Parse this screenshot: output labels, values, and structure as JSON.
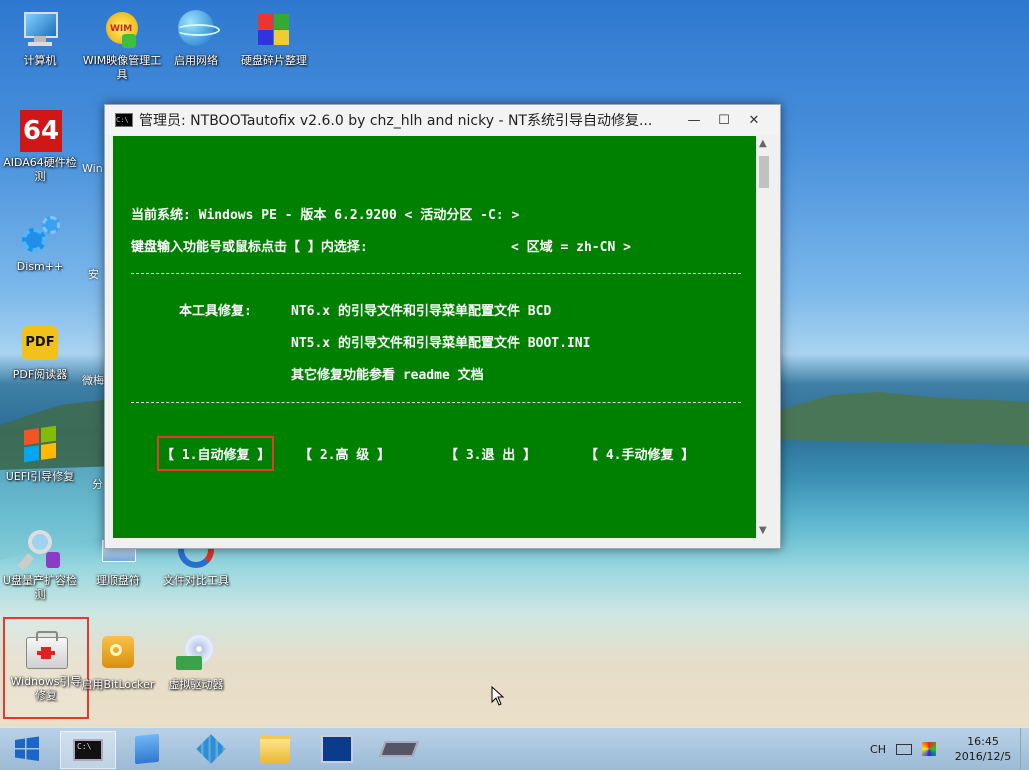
{
  "desktop_icons": [
    {
      "label": "计算机",
      "icon": "computer-icon"
    },
    {
      "label": "WIM映像管理工具",
      "icon": "wim-icon"
    },
    {
      "label": "启用网络",
      "icon": "network-icon"
    },
    {
      "label": "硬盘碎片整理",
      "icon": "defrag-icon"
    },
    {
      "label": "AIDA64硬件检测",
      "icon": "aida64-icon",
      "badge": "64"
    },
    {
      "label": "Dism++",
      "icon": "dism-icon"
    },
    {
      "label": "PDF阅读器",
      "icon": "pdf-icon",
      "badge": "PDF"
    },
    {
      "label": "UEFI引导修复",
      "icon": "uefi-icon"
    },
    {
      "label": "U盘量产扩容检测",
      "icon": "usb-check-icon"
    },
    {
      "label": "理顺盘符",
      "icon": "drive-letter-icon"
    },
    {
      "label": "文件对比工具",
      "icon": "file-compare-icon"
    },
    {
      "label": "Widnows引导修复",
      "icon": "toolbox-icon"
    },
    {
      "label": "启用BitLocker",
      "icon": "bitlocker-icon"
    },
    {
      "label": "虚拟驱动器",
      "icon": "virtual-drive-icon"
    }
  ],
  "partial_labels": [
    "Win",
    "安",
    "微梅",
    "分"
  ],
  "window": {
    "title": "管理员: NTBOOTautofix v2.6.0 by chz_hlh and nicky - NT系统引导自动修复...",
    "cmd_icon_text": "C:\\",
    "minimize": "—",
    "maximize": "☐",
    "close": "✕",
    "console": {
      "line1": "当前系统: Windows PE - 版本 6.2.9200  < 活动分区 -C: >",
      "line2a": "键盘输入功能号或鼠标点击【 】内选择:",
      "line2b": "< 区域 = zh-CN >",
      "repair_label": "本工具修复:",
      "repair1": "NT6.x 的引导文件和引导菜单配置文件 BCD",
      "repair2": "NT5.x 的引导文件和引导菜单配置文件 BOOT.INI",
      "repair3": "其它修复功能参看 readme 文档",
      "options": [
        "【 1.自动修复 】",
        "【  2.高  级  】",
        "【  3.退  出  】",
        "【 4.手动修复 】"
      ]
    }
  },
  "taskbar": {
    "cmd_text": "C:\\",
    "lang": "CH",
    "time": "16:45",
    "date": "2016/12/5"
  }
}
